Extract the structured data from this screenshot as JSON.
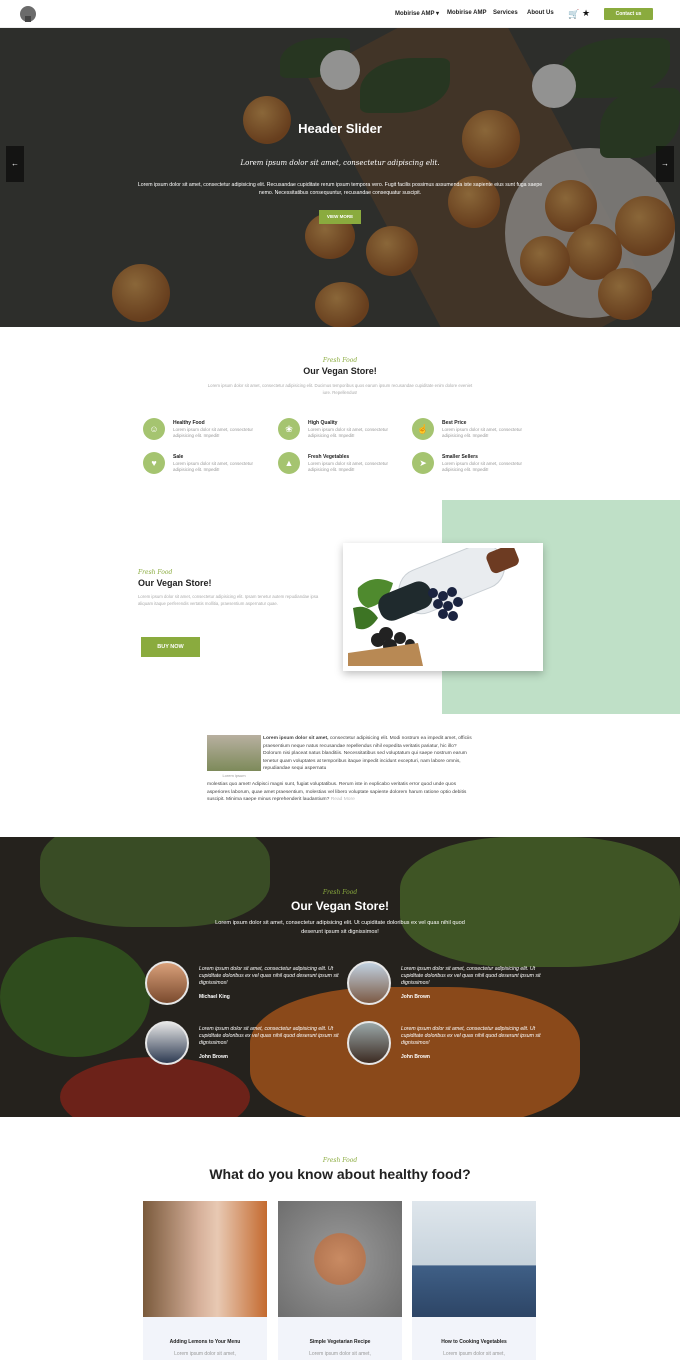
{
  "nav": {
    "links": [
      "Mobirise AMP ▾",
      "Mobirise AMP",
      "Services",
      "About Us"
    ],
    "contact_label": "Contact us"
  },
  "hero": {
    "title": "Header Slider",
    "subtitle": "Lorem ipsum dolor sit amet, consectetur adipiscing elit.",
    "description": "Lorem ipsum dolor sit amet, consectetur adipisicing elit. Recusandae cupiditate rerum ipsum tempora vero. Fugit facilis possimus assumenda iste sapiente eius sunt fuga saepe nemo. Necessitatibus consequuntur, recusandae consequatur suscipit.",
    "button_label": "VIEW MORE",
    "prev_arrow": "←",
    "next_arrow": "→"
  },
  "store": {
    "fresh_label": "Fresh Food",
    "title": "Our Vegan Store!",
    "description": "Lorem ipsum dolor sit amet, consectetur adipisicing elit. Ducimus temporibus quos earum ipsum recusandae cupiditate enim dolore eveniet iure. Repellendus!",
    "features": [
      {
        "icon": "smile-icon",
        "glyph": "☺",
        "title": "Healthy Food",
        "text": "Lorem ipsum dolor sit amet, consectetur adipisicing elit. Impedit!"
      },
      {
        "icon": "medal-icon",
        "glyph": "❀",
        "title": "High Quality",
        "text": "Lorem ipsum dolor sit amet, consectetur adipisicing elit. Impedit!"
      },
      {
        "icon": "thumbs-up-icon",
        "glyph": "☝",
        "title": "Best Price",
        "text": "Lorem ipsum dolor sit amet, consectetur adipisicing elit. Impedit!"
      },
      {
        "icon": "heart-icon",
        "glyph": "♥",
        "title": "Sale",
        "text": "Lorem ipsum dolor sit amet, consectetur adipisicing elit. Impedit!"
      },
      {
        "icon": "user-icon",
        "glyph": "▲",
        "title": "Fresh Vegetables",
        "text": "Lorem ipsum dolor sit amet, consectetur adipisicing elit. Impedit!"
      },
      {
        "icon": "send-icon",
        "glyph": "➤",
        "title": "Smaller Sellers",
        "text": "Lorem ipsum dolor sit amet, consectetur adipisicing elit. Impedit!"
      }
    ]
  },
  "promo": {
    "fresh_label": "Fresh Food",
    "title": "Our Vegan Store!",
    "description": "Lorem ipsum dolor sit amet, consectetur adipisicing elit. Ipsam tenetur autem repudiandae ipsa aliquam itaque perferendis vertatis mollitia, praesentium aspernatur quae.",
    "button_label": "BUY NOW"
  },
  "article": {
    "caption": "Lorem ipsum",
    "lead_bold": "Lorem ipsum dolor sit amet,",
    "text_right": "consectetur adipisicing elit. Modi nostrum ea impedit amet, officiis praesentium neque natus recusandae repellendus nihil expedita veritatis pariatur, hic illo? Dolorum nisi placeat natus blanditiis. Necessitatibus sed voluptatum qui saepe nostrum earum tenetur quam voluptates at temporibus itaque impedit incidunt excepturi, nam labore omnis, repudiandae sequi aspernatu",
    "text_bottom": "molestias quo amet! Adipisci magni sunt, fugiat voluptatibus. Rerum iste in explicabo veritatis error quod unde quos asperiores laborum, quae amet praesentium, molestias vel libero voluptate sapiente dolorem harum ratione optio debitis suscipit. Minima saepe minus reprehenderit laudantium?",
    "read_more": "Read More"
  },
  "testimonials": {
    "fresh_label": "Fresh Food",
    "title": "Our Vegan Store!",
    "description": "Lorem ipsum dolor sit amet, consectetur adipisicing elit. Ut cupiditate doloribus ex vel quas nihil quod deserunt ipsum sit dignissimos!",
    "items": [
      {
        "text": "Lorem ipsum dolor sit amet, consectetur adipisicing elit. Ut cupiditate doloribus ex vel quas nihil quod deserunt ipsum sit dignissimos!",
        "name": "Michael King"
      },
      {
        "text": "Lorem ipsum dolor sit amet, consectetur adipisicing elit. Ut cupiditate doloribus ex vel quas nihil quod deserunt ipsum sit dignissimos!",
        "name": "John Brown"
      },
      {
        "text": "Lorem ipsum dolor sit amet, consectetur adipisicing elit. Ut cupiditate doloribus ex vel quas nihil quod deserunt ipsum sit dignissimos!",
        "name": "John Brown"
      },
      {
        "text": "Lorem ipsum dolor sit amet, consectetur adipisicing elit. Ut cupiditate doloribus ex vel quas nihil quod deserunt ipsum sit dignissimos!",
        "name": "John Brown"
      }
    ]
  },
  "healthy": {
    "fresh_label": "Fresh Food",
    "title": "What do you know about healthy food?",
    "cards": [
      {
        "title": "Adding Lemons to Your Menu",
        "text": "Lorem ipsum dolor sit amet,"
      },
      {
        "title": "Simple Vegetarian Recipe",
        "text": "Lorem ipsum dolor sit amet,"
      },
      {
        "title": "How to Cooking Vegetables",
        "text": "Lorem ipsum dolor sit amet,"
      }
    ]
  },
  "colors": {
    "accent": "#8aab3e",
    "mint": "#bfe0c7"
  }
}
